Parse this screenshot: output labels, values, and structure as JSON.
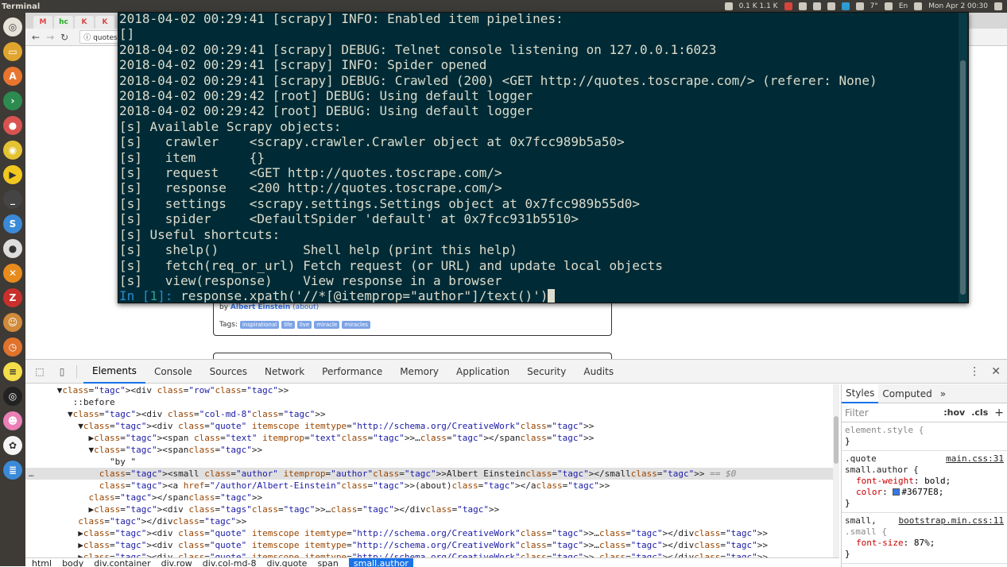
{
  "topbar": {
    "title": "Terminal",
    "net": "0.1 K 1.1 K",
    "weather": "7°",
    "lang": "En",
    "clock": "Mon Apr 2 00:30"
  },
  "launcher": {
    "items": [
      "files",
      "software-center",
      "terminal",
      "toggle",
      "chrome",
      "player",
      "terminal-2",
      "sync",
      "webcam",
      "xampp",
      "filezilla",
      "tomcat",
      "clock",
      "notes",
      "obs",
      "avatar",
      "colors",
      "stack"
    ]
  },
  "browser": {
    "tabs": [
      "M",
      "hc",
      "K",
      "K"
    ],
    "url": "quotes.t"
  },
  "page": {
    "by_prefix": "by",
    "author": "Albert Einstein",
    "about": "(about)",
    "tags_label": "Tags:",
    "tags": [
      "inspirational",
      "life",
      "live",
      "miracle",
      "miracles"
    ]
  },
  "terminal": {
    "lines": [
      "2018-04-02 00:29:41 [scrapy] INFO: Enabled item pipelines:",
      "[]",
      "2018-04-02 00:29:41 [scrapy] DEBUG: Telnet console listening on 127.0.0.1:6023",
      "2018-04-02 00:29:41 [scrapy] INFO: Spider opened",
      "2018-04-02 00:29:41 [scrapy] DEBUG: Crawled (200) <GET http://quotes.toscrape.com/> (referer: None)",
      "2018-04-02 00:29:42 [root] DEBUG: Using default logger",
      "2018-04-02 00:29:42 [root] DEBUG: Using default logger",
      "[s] Available Scrapy objects:",
      "[s]   crawler    <scrapy.crawler.Crawler object at 0x7fcc989b5a50>",
      "[s]   item       {}",
      "[s]   request    <GET http://quotes.toscrape.com/>",
      "[s]   response   <200 http://quotes.toscrape.com/>",
      "[s]   settings   <scrapy.settings.Settings object at 0x7fcc989b55d0>",
      "[s]   spider     <DefaultSpider 'default' at 0x7fcc931b5510>",
      "[s] Useful shortcuts:",
      "[s]   shelp()           Shell help (print this help)",
      "[s]   fetch(req_or_url) Fetch request (or URL) and update local objects",
      "[s]   view(response)    View response in a browser"
    ],
    "prompt_in": "In [",
    "prompt_num": "1",
    "prompt_close": "]: ",
    "command": "response.xpath('//*[@itemprop=\"author\"]/text()')"
  },
  "devtools": {
    "tabs": [
      "Elements",
      "Console",
      "Sources",
      "Network",
      "Performance",
      "Memory",
      "Application",
      "Security",
      "Audits"
    ],
    "active_tab": "Elements",
    "dom_lines": [
      "      ▼<div class=\"row\">",
      "         ::before",
      "        ▼<div class=\"col-md-8\">",
      "          ▼<div class=\"quote\" itemscope itemtype=\"http://schema.org/CreativeWork\">",
      "            ▶<span class=\"text\" itemprop=\"text\">…</span>",
      "            ▼<span>",
      "                \"by \"",
      "              <small class=\"author\" itemprop=\"author\">Albert Einstein</small> == $0",
      "              <a href=\"/author/Albert-Einstein\">(about)</a>",
      "            </span>",
      "            ▶<div class=\"tags\">…</div>",
      "          </div>",
      "          ▶<div class=\"quote\" itemscope itemtype=\"http://schema.org/CreativeWork\">…</div>",
      "          ▶<div class=\"quote\" itemscope itemtype=\"http://schema.org/CreativeWork\">…</div>",
      "          ▶<div class=\"quote\" itemscope itemtype=\"http://schema.org/CreativeWork\">…</div>"
    ],
    "selected_line": 7,
    "breadcrumbs": [
      "html",
      "body",
      "div.container",
      "div.row",
      "div.col-md-8",
      "div.quote",
      "span",
      "small.author"
    ],
    "active_crumb": "small.author",
    "styles": {
      "tabs": [
        "Styles",
        "Computed"
      ],
      "more": "»",
      "filter_placeholder": "Filter",
      "hov": ":hov",
      "cls": ".cls",
      "plus": "+",
      "element_style": "element.style {",
      "close_brace": "}",
      "rule1_sel_a": ".quote",
      "rule1_sel_b": "small.author {",
      "rule1_src": "main.css:31",
      "rule1_p1_name": "font-weight",
      "rule1_p1_val": "bold;",
      "rule1_p2_name": "color",
      "rule1_p2_val": "#3677E8;",
      "swatch_color": "#3677E8",
      "rule2_sel_a": "small,",
      "rule2_sel_b": ".small {",
      "rule2_src": "bootstrap.min.css:11",
      "rule2_p1_name": "font-size",
      "rule2_p1_val": "87%;"
    }
  },
  "colors": {
    "terminal_bg": "#002b36",
    "accent": "#1a73e8",
    "link": "#3677E8"
  }
}
